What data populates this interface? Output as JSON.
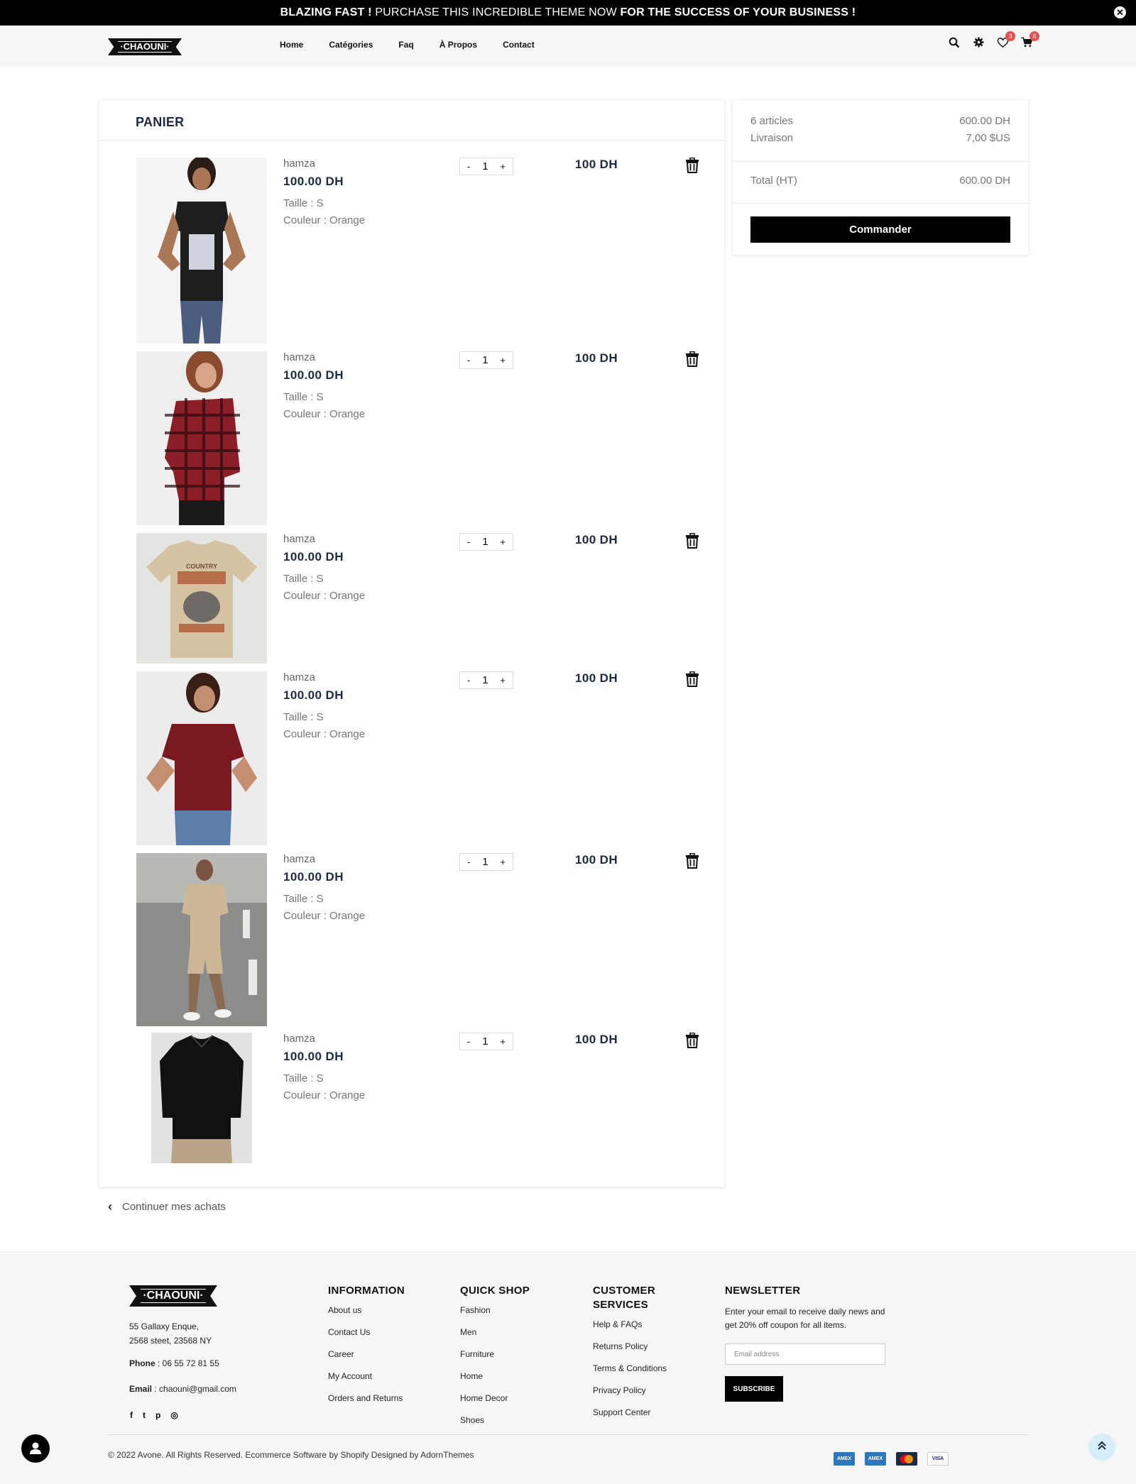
{
  "announcement": {
    "part1": "BLAZING FAST !",
    "part2": "PURCHASE THIS INCREDIBLE THEME NOW",
    "part3": "FOR THE SUCCESS OF YOUR BUSINESS !",
    "close": "✕"
  },
  "brand": {
    "logo_text": "·CHAOUNI·"
  },
  "nav": {
    "items": [
      "Home",
      "Catégories",
      "Faq",
      "À Propos",
      "Contact"
    ]
  },
  "header_icons": {
    "search": "search-icon",
    "settings": "gear-icon",
    "wishlist": "heart-icon",
    "wishlist_count": "3",
    "cart": "cart-icon",
    "cart_count": "6"
  },
  "cart": {
    "title": "PANIER",
    "items": [
      {
        "name": "hamza",
        "price": "100.00  DH",
        "size": "Taille : S",
        "color": "Couleur : Orange",
        "qty": "1",
        "total": "100  DH",
        "minus": "-",
        "plus": "+"
      },
      {
        "name": "hamza",
        "price": "100.00  DH",
        "size": "Taille : S",
        "color": "Couleur : Orange",
        "qty": "1",
        "total": "100  DH",
        "minus": "-",
        "plus": "+"
      },
      {
        "name": "hamza",
        "price": "100.00  DH",
        "size": "Taille : S",
        "color": "Couleur : Orange",
        "qty": "1",
        "total": "100  DH",
        "minus": "-",
        "plus": "+"
      },
      {
        "name": "hamza",
        "price": "100.00  DH",
        "size": "Taille : S",
        "color": "Couleur : Orange",
        "qty": "1",
        "total": "100  DH",
        "minus": "-",
        "plus": "+"
      },
      {
        "name": "hamza",
        "price": "100.00  DH",
        "size": "Taille : S",
        "color": "Couleur : Orange",
        "qty": "1",
        "total": "100  DH",
        "minus": "-",
        "plus": "+"
      },
      {
        "name": "hamza",
        "price": "100.00  DH",
        "size": "Taille : S",
        "color": "Couleur : Orange",
        "qty": "1",
        "total": "100  DH",
        "minus": "-",
        "plus": "+"
      }
    ],
    "continue_label": "Continuer mes achats"
  },
  "summary": {
    "articles_label": "6 articles",
    "articles_value": "600.00  DH",
    "shipping_label": "Livraison",
    "shipping_value": "7,00 $US",
    "total_label": "Total (HT)",
    "total_value": "600.00  DH",
    "order_button": "Commander"
  },
  "footer": {
    "address_line1": "55 Gallaxy Enque,",
    "address_line2": "2568 steet, 23568 NY",
    "phone_label": "Phone",
    "phone_value": " : 06 55 72 81 55",
    "email_label": "Email",
    "email_value": " : chaouni@gmail.com",
    "social": [
      "f",
      "t",
      "p",
      "◎"
    ],
    "information": {
      "title": "INFORMATION",
      "links": [
        "About us",
        "Contact Us",
        "Career",
        "My Account",
        "Orders and Returns"
      ]
    },
    "quick_shop": {
      "title": "QUICK SHOP",
      "links": [
        "Fashion",
        "Men",
        "Furniture",
        "Home",
        "Home Decor",
        "Shoes"
      ]
    },
    "customer_services": {
      "title": "CUSTOMER SERVICES",
      "links": [
        "Help & FAQs",
        "Returns Policy",
        "Terms & Conditions",
        "Privacy Policy",
        "Support Center"
      ]
    },
    "newsletter": {
      "title": "NEWSLETTER",
      "text": "Enter your email to receive daily news and get 20% off coupon for all items.",
      "placeholder": "Email address",
      "button": "SUBSCRIBE"
    },
    "copyright": "© 2022 Avone. All Rights Reserved. Ecommerce Software by Shopify Designed by AdornThemes",
    "payment_cards": [
      "AMEX",
      "AMEX",
      "MC",
      "VISA"
    ]
  },
  "colors": {
    "accent_dark": "#1b2b44",
    "badge": "#e94f4f",
    "black": "#000000",
    "footer_bg": "#f6f6f6"
  }
}
